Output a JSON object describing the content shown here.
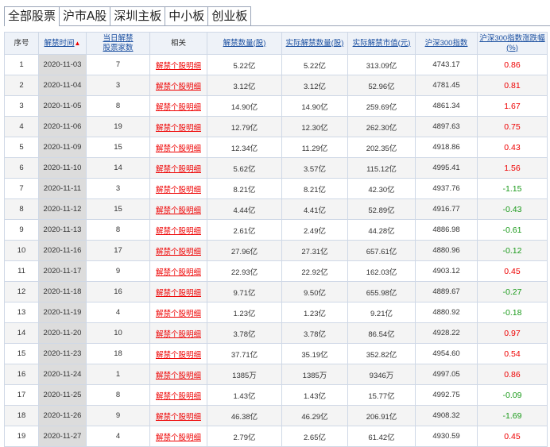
{
  "tabs": [
    "全部股票",
    "沪市A股",
    "深圳主板",
    "中小板",
    "创业板"
  ],
  "headers": {
    "index": "序号",
    "date": "解禁时间",
    "count": "当日解禁股票家数",
    "related": "相关",
    "qty": "解禁数量(股)",
    "actual_qty": "实际解禁数量(股)",
    "actual_value": "实际解禁市值(元)",
    "hs300": "沪深300指数",
    "hs300_change": "沪深300指数涨跌幅(%)"
  },
  "link_label": "解禁个股明细",
  "rows": [
    [
      "1",
      "2020-11-03",
      "7",
      "5.22亿",
      "5.22亿",
      "313.09亿",
      "4743.17",
      "0.86"
    ],
    [
      "2",
      "2020-11-04",
      "3",
      "3.12亿",
      "3.12亿",
      "52.96亿",
      "4781.45",
      "0.81"
    ],
    [
      "3",
      "2020-11-05",
      "8",
      "14.90亿",
      "14.90亿",
      "259.69亿",
      "4861.34",
      "1.67"
    ],
    [
      "4",
      "2020-11-06",
      "19",
      "12.79亿",
      "12.30亿",
      "262.30亿",
      "4897.63",
      "0.75"
    ],
    [
      "5",
      "2020-11-09",
      "15",
      "12.34亿",
      "11.29亿",
      "202.35亿",
      "4918.86",
      "0.43"
    ],
    [
      "6",
      "2020-11-10",
      "14",
      "5.62亿",
      "3.57亿",
      "115.12亿",
      "4995.41",
      "1.56"
    ],
    [
      "7",
      "2020-11-11",
      "3",
      "8.21亿",
      "8.21亿",
      "42.30亿",
      "4937.76",
      "-1.15"
    ],
    [
      "8",
      "2020-11-12",
      "15",
      "4.44亿",
      "4.41亿",
      "52.89亿",
      "4916.77",
      "-0.43"
    ],
    [
      "9",
      "2020-11-13",
      "8",
      "2.61亿",
      "2.49亿",
      "44.28亿",
      "4886.98",
      "-0.61"
    ],
    [
      "10",
      "2020-11-16",
      "17",
      "27.96亿",
      "27.31亿",
      "657.61亿",
      "4880.96",
      "-0.12"
    ],
    [
      "11",
      "2020-11-17",
      "9",
      "22.93亿",
      "22.92亿",
      "162.03亿",
      "4903.12",
      "0.45"
    ],
    [
      "12",
      "2020-11-18",
      "16",
      "9.71亿",
      "9.50亿",
      "655.98亿",
      "4889.67",
      "-0.27"
    ],
    [
      "13",
      "2020-11-19",
      "4",
      "1.23亿",
      "1.23亿",
      "9.21亿",
      "4880.92",
      "-0.18"
    ],
    [
      "14",
      "2020-11-20",
      "10",
      "3.78亿",
      "3.78亿",
      "86.54亿",
      "4928.22",
      "0.97"
    ],
    [
      "15",
      "2020-11-23",
      "18",
      "37.71亿",
      "35.19亿",
      "352.82亿",
      "4954.60",
      "0.54"
    ],
    [
      "16",
      "2020-11-24",
      "1",
      "1385万",
      "1385万",
      "9346万",
      "4997.05",
      "0.86"
    ],
    [
      "17",
      "2020-11-25",
      "8",
      "1.43亿",
      "1.43亿",
      "15.77亿",
      "4992.75",
      "-0.09"
    ],
    [
      "18",
      "2020-11-26",
      "9",
      "46.38亿",
      "46.29亿",
      "206.91亿",
      "4908.32",
      "-1.69"
    ],
    [
      "19",
      "2020-11-27",
      "4",
      "2.79亿",
      "2.65亿",
      "61.42亿",
      "4930.59",
      "0.45"
    ]
  ]
}
